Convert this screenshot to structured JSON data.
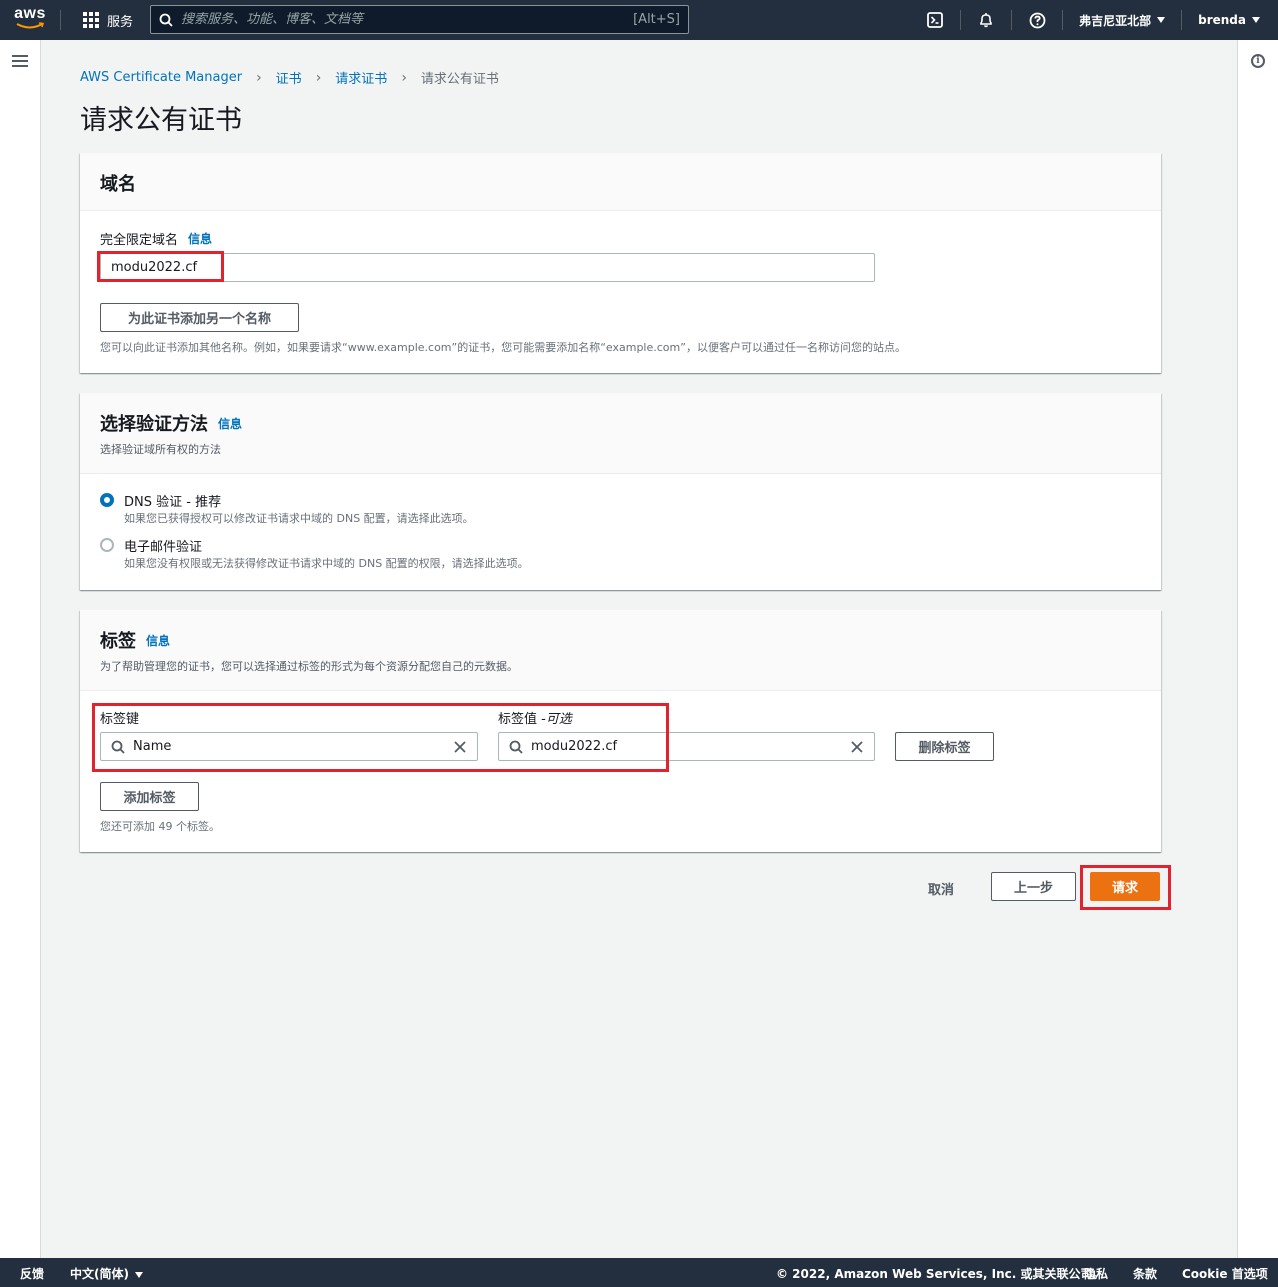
{
  "topnav": {
    "logo_text": "aws",
    "services_label": "服务",
    "search_placeholder": "搜索服务、功能、博客、文档等",
    "search_shortcut": "[Alt+S]",
    "region_label": "弗吉尼亚北部",
    "user_label": "brenda"
  },
  "breadcrumb": {
    "items": [
      "AWS Certificate Manager",
      "证书",
      "请求证书"
    ],
    "current": "请求公有证书"
  },
  "page_title": "请求公有证书",
  "domain_panel": {
    "title": "域名",
    "field_label": "完全限定域名",
    "info": "信息",
    "domain_value": "modu2022.cf",
    "add_name_button": "为此证书添加另一个名称",
    "hint": "您可以向此证书添加其他名称。例如，如果要请求“www.example.com”的证书，您可能需要添加名称“example.com”，以便客户可以通过任一名称访问您的站点。"
  },
  "validation_panel": {
    "title": "选择验证方法",
    "info": "信息",
    "desc": "选择验证域所有权的方法",
    "options": [
      {
        "label": "DNS 验证 - 推荐",
        "desc": "如果您已获得授权可以修改证书请求中域的 DNS 配置，请选择此选项。"
      },
      {
        "label": "电子邮件验证",
        "desc": "如果您没有权限或无法获得修改证书请求中域的 DNS 配置的权限，请选择此选项。"
      }
    ]
  },
  "tags_panel": {
    "title": "标签",
    "info": "信息",
    "desc": "为了帮助管理您的证书，您可以选择通过标签的形式为每个资源分配您自己的元数据。",
    "key_label": "标签键",
    "value_label": "标签值 - ",
    "value_optional": "可选",
    "key_value": "Name",
    "tag_value": "modu2022.cf",
    "remove_button": "删除标签",
    "add_button": "添加标签",
    "remaining": "您还可添加 49 个标签。"
  },
  "actions": {
    "cancel": "取消",
    "previous": "上一步",
    "submit": "请求"
  },
  "footer": {
    "feedback": "反馈",
    "language": "中文(简体)",
    "copyright": "© 2022, Amazon Web Services, Inc. 或其关联公司。",
    "privacy": "隐私",
    "terms": "条款",
    "cookie": "Cookie 首选项"
  },
  "colors": {
    "nav_bg": "#232f3e",
    "link": "#0073bb",
    "primary": "#ec7211",
    "highlight": "#e0232e"
  }
}
